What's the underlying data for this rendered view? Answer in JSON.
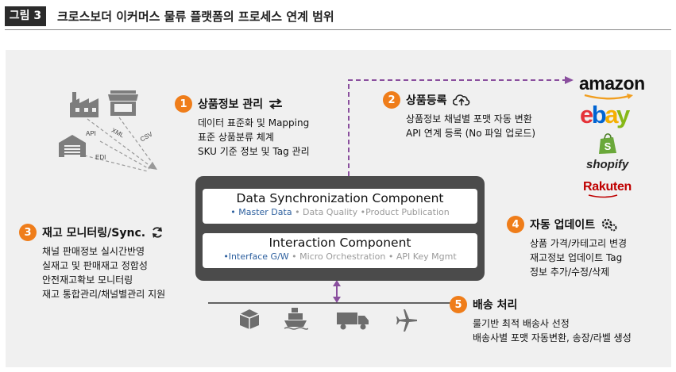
{
  "header": {
    "figure_label": "그림 3",
    "title": "크로스보더 이커머스 물류 플랫폼의 프로세스 연계 범위"
  },
  "sources": {
    "labels": [
      "API",
      "XML",
      "CSV",
      "EDI"
    ]
  },
  "steps": [
    {
      "num": "1",
      "title": "상품정보 관리",
      "icon": "exchange-arrows-icon",
      "lines": [
        "데이터 표준화 및 Mapping",
        "표준 상품분류 체계",
        "SKU 기준 정보 및 Tag 관리"
      ]
    },
    {
      "num": "2",
      "title": "상품등록",
      "icon": "cloud-upload-icon",
      "lines": [
        "상품정보 채널별 포맷 자동 변환",
        "API 연계 등록 (No 파일 업로드)"
      ]
    },
    {
      "num": "3",
      "title": "재고 모니터링/Sync.",
      "icon": "sync-icon",
      "lines": [
        "채널 판매정보 실시간반영",
        "실재고 및 판매재고 정합성",
        "안전재고확보 모니터링",
        "재고 통합관리/채널별관리 지원"
      ]
    },
    {
      "num": "4",
      "title": "자동 업데이트",
      "icon": "gears-icon",
      "lines": [
        "상품 가격/카테고리 변경",
        "재고정보 업데이트 Tag",
        "정보 추가/수정/삭제"
      ]
    },
    {
      "num": "5",
      "title": "배송 처리",
      "icon": "",
      "lines": [
        "룰기반 최적 배송사 선정",
        "배송사별 포맷 자동변환, 송장/라벨 생성"
      ]
    }
  ],
  "core": {
    "data_sync": {
      "title": "Data Synchronization Component",
      "items": [
        "• Master Data",
        "• Data Quality",
        "•Product Publication"
      ]
    },
    "interaction": {
      "title": "Interaction Component",
      "items": [
        "•Interface G/W",
        "• Micro Orchestration",
        "• API Key Mgmt"
      ]
    }
  },
  "marketplaces": [
    "amazon",
    "ebay",
    "shopify",
    "Rakuten"
  ],
  "colors": {
    "accent": "#ef7d1a",
    "purple": "#8a4f9e",
    "core_bg": "#4b4b4b",
    "highlight_blue": "#2c5f9e"
  }
}
